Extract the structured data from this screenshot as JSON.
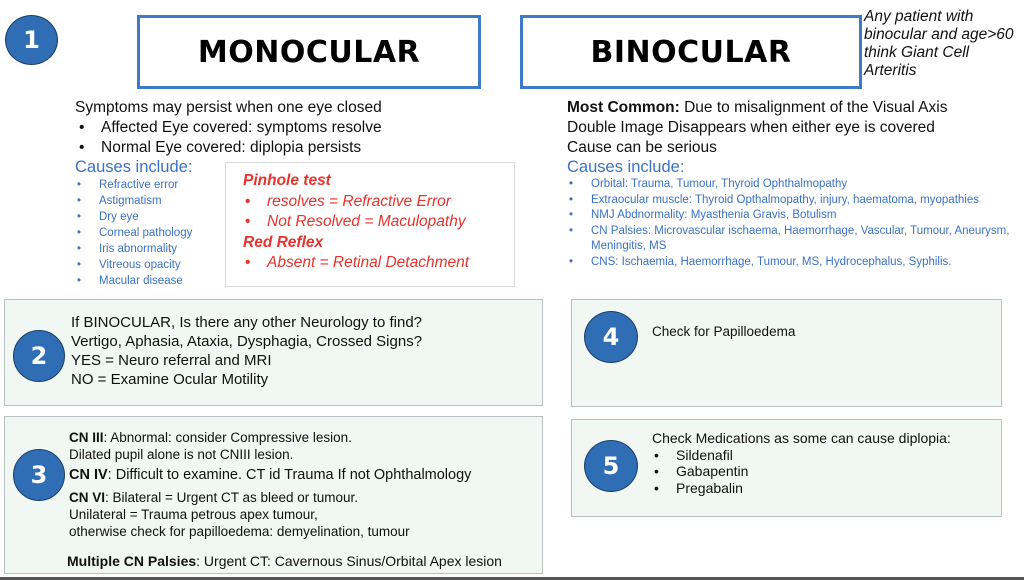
{
  "header": {
    "step1_number": "1",
    "monocular_title": "MONOCULAR",
    "binocular_title": "BINOCULAR",
    "gca_note": "Any patient with binocular and age>60 think Giant Cell Arteritis"
  },
  "monocular": {
    "intro": "Symptoms may persist when one eye closed",
    "bullets": [
      "Affected Eye covered: symptoms resolve",
      "Normal Eye covered: diplopia persists"
    ],
    "causes_heading": "Causes include:",
    "causes": [
      "Refractive error",
      "Astigmatism",
      "Dry eye",
      "Corneal pathology",
      "Iris abnormality",
      "Vitreous opacity",
      "Macular disease"
    ],
    "tests": {
      "pinhole_heading": "Pinhole test",
      "pinhole_items": [
        "resolves = Refractive Error",
        "Not Resolved = Maculopathy"
      ],
      "red_reflex_heading": "Red Reflex",
      "red_reflex_items": [
        "Absent = Retinal Detachment"
      ]
    }
  },
  "binocular": {
    "most_common_label": "Most Common:",
    "most_common_text": " Due to misalignment of the Visual Axis",
    "line2": "Double Image Disappears when either eye is covered",
    "line3": "Cause can be serious",
    "causes_heading": "Causes include:",
    "causes": [
      "Orbital: Trauma, Tumour, Thyroid Ophthalmopathy",
      "Extraocular muscle: Thyroid Opthalmopathy, injury, haematoma, myopathies",
      "NMJ Abdnormality: Myasthenia Gravis, Botulism",
      "CN Palsies: Microvascular ischaema, Haemorrhage, Vascular, Tumour, Aneurysm, Meningitis, MS",
      "CNS: Ischaemia, Haemorrhage, Tumour, MS, Hydrocephalus, Syphilis."
    ]
  },
  "step2": {
    "number": "2",
    "lines": [
      "If BINOCULAR, Is there any other Neurology to find?",
      "Vertigo, Aphasia, Ataxia, Dysphagia, Crossed Signs?",
      "YES = Neuro referral and MRI",
      "NO = Examine Ocular Motility"
    ]
  },
  "step3": {
    "number": "3",
    "cn3_label": "CN III",
    "cn3_text": ": Abnormal: consider Compressive lesion.",
    "cn3_line2": "Dilated pupil alone is not CNIII lesion.",
    "cn4_label": "CN IV",
    "cn4_text": ": Difficult to examine. CT id Trauma If not Ophthalmology",
    "cn6_label": "CN VI",
    "cn6_text": ": Bilateral = Urgent CT as bleed or tumour.",
    "cn6_line2": "Unilateral = Trauma petrous apex tumour,",
    "cn6_line3": "otherwise check for papilloedema: demyelination, tumour",
    "multi_label": "Multiple CN Palsies",
    "multi_text": ": Urgent CT: Cavernous Sinus/Orbital Apex lesion"
  },
  "step4": {
    "number": "4",
    "text": "Check for Papilloedema"
  },
  "step5": {
    "number": "5",
    "intro": "Check Medications as some can cause diplopia:",
    "meds": [
      "Sildenafil",
      "Gabapentin",
      "Pregabalin"
    ]
  },
  "colors": {
    "accent_blue": "#2f6db5",
    "causes_blue": "#3b72c4",
    "warning_red": "#e8322c",
    "panel_bg": "#f1f7f3"
  }
}
